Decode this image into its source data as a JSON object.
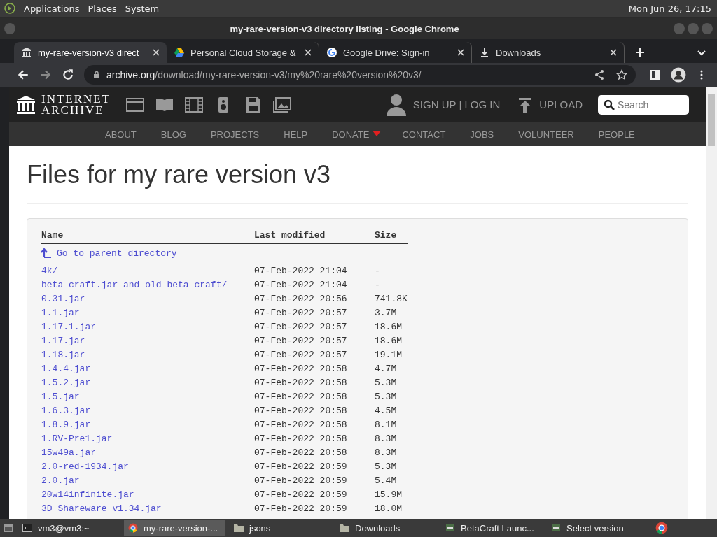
{
  "top_panel": {
    "menus": [
      "Applications",
      "Places",
      "System"
    ],
    "clock": "Mon Jun 26, 17:15"
  },
  "window": {
    "title": "my-rare-version-v3 directory listing - Google Chrome"
  },
  "tabs": [
    {
      "label": "my-rare-version-v3 direct",
      "kind": "archive",
      "selected": true
    },
    {
      "label": "Personal Cloud Storage & ",
      "kind": "drive",
      "selected": false
    },
    {
      "label": "Google Drive: Sign-in",
      "kind": "google",
      "selected": false
    },
    {
      "label": "Downloads",
      "kind": "download",
      "selected": false
    }
  ],
  "address_bar": {
    "host": "archive.org",
    "path": "/download/my-rare-version-v3/my%20rare%20version%20v3/"
  },
  "site_header": {
    "logo_top": "INTERNET",
    "logo_bottom": "ARCHIVE",
    "account": "SIGN UP | LOG IN",
    "upload": "UPLOAD",
    "search": {
      "placeholder": "Search"
    }
  },
  "nav": [
    "ABOUT",
    "BLOG",
    "PROJECTS",
    "HELP",
    "DONATE",
    "CONTACT",
    "JOBS",
    "VOLUNTEER",
    "PEOPLE"
  ],
  "page": {
    "heading": "Files for my rare version v3",
    "columns": [
      "Name",
      "Last modified",
      "Size"
    ],
    "parent_link": "Go to parent directory",
    "rows": [
      {
        "name": "4k/",
        "modified": "07-Feb-2022 21:04",
        "size": "-"
      },
      {
        "name": "beta craft.jar and old beta craft/",
        "modified": "07-Feb-2022 21:04",
        "size": "-"
      },
      {
        "name": "0.31.jar",
        "modified": "07-Feb-2022 20:56",
        "size": "741.8K"
      },
      {
        "name": "1.1.jar",
        "modified": "07-Feb-2022 20:57",
        "size": "3.7M"
      },
      {
        "name": "1.17.1.jar",
        "modified": "07-Feb-2022 20:57",
        "size": "18.6M"
      },
      {
        "name": "1.17.jar",
        "modified": "07-Feb-2022 20:57",
        "size": "18.6M"
      },
      {
        "name": "1.18.jar",
        "modified": "07-Feb-2022 20:57",
        "size": "19.1M"
      },
      {
        "name": "1.4.4.jar",
        "modified": "07-Feb-2022 20:58",
        "size": "4.7M"
      },
      {
        "name": "1.5.2.jar",
        "modified": "07-Feb-2022 20:58",
        "size": "5.3M"
      },
      {
        "name": "1.5.jar",
        "modified": "07-Feb-2022 20:58",
        "size": "5.3M"
      },
      {
        "name": "1.6.3.jar",
        "modified": "07-Feb-2022 20:58",
        "size": "4.5M"
      },
      {
        "name": "1.8.9.jar",
        "modified": "07-Feb-2022 20:58",
        "size": "8.1M"
      },
      {
        "name": "1.RV-Pre1.jar",
        "modified": "07-Feb-2022 20:58",
        "size": "8.3M"
      },
      {
        "name": "15w49a.jar",
        "modified": "07-Feb-2022 20:58",
        "size": "8.3M"
      },
      {
        "name": "2.0-red-1934.jar",
        "modified": "07-Feb-2022 20:59",
        "size": "5.3M"
      },
      {
        "name": "2.0.jar",
        "modified": "07-Feb-2022 20:59",
        "size": "5.4M"
      },
      {
        "name": "20w14infinite.jar",
        "modified": "07-Feb-2022 20:59",
        "size": "15.9M"
      },
      {
        "name": "3D Shareware v1.34.jar",
        "modified": "07-Feb-2022 20:59",
        "size": "18.0M"
      }
    ]
  },
  "taskbar": [
    {
      "label": "vm3@vm3:~",
      "kind": "terminal",
      "selected": false
    },
    {
      "label": "my-rare-version-...",
      "kind": "chrome",
      "selected": true
    },
    {
      "label": "jsons",
      "kind": "folder",
      "selected": false
    },
    {
      "label": "Downloads",
      "kind": "folder",
      "selected": false
    },
    {
      "label": "BetaCraft Launc...",
      "kind": "app",
      "selected": false
    },
    {
      "label": "Select version",
      "kind": "app",
      "selected": false
    }
  ]
}
